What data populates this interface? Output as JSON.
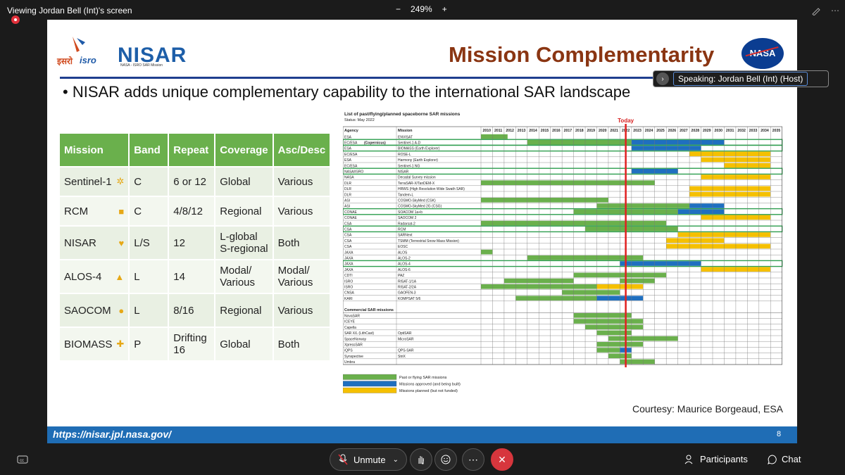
{
  "window": {
    "title": "Viewing Jordan Bell (Int)'s screen",
    "zoom": "249%",
    "zoom_minus": "−",
    "zoom_plus": "+"
  },
  "slide": {
    "isro_hindi": "इसरो",
    "isro_text": "isro",
    "nisar_logo": "NISAR",
    "nisar_sub": "NASA - ISRO SAR Mission",
    "title": "Mission Complementarity",
    "nasa_logo": "NASA",
    "bullet": "• NISAR adds unique complementary capability to the international SAR landscape",
    "table_headers": [
      "Mission",
      "Band",
      "Repeat",
      "Coverage",
      "Asc/Desc"
    ],
    "table_rows": [
      {
        "mission": "Sentinel-1",
        "symbol": "✲",
        "band": "C",
        "repeat": "6 or 12",
        "coverage": "Global",
        "ascdesc": "Various"
      },
      {
        "mission": "RCM",
        "symbol": "■",
        "band": "C",
        "repeat": "4/8/12",
        "coverage": "Regional",
        "ascdesc": "Various"
      },
      {
        "mission": "NISAR",
        "symbol": "♥",
        "band": "L/S",
        "repeat": "12",
        "coverage": "L-global\nS-regional",
        "ascdesc": "Both"
      },
      {
        "mission": "ALOS-4",
        "symbol": "▲",
        "band": "L",
        "repeat": "14",
        "coverage": "Modal/\nVarious",
        "ascdesc": "Modal/\nVarious"
      },
      {
        "mission": "SAOCOM",
        "symbol": "●",
        "band": "L",
        "repeat": "8/16",
        "coverage": "Regional",
        "ascdesc": "Various"
      },
      {
        "mission": "BIOMASS",
        "symbol": "✚",
        "band": "P",
        "repeat": "Drifting\n16",
        "coverage": "Global",
        "ascdesc": "Both"
      }
    ],
    "courtesy": "Courtesy: Maurice Borgeaud, ESA",
    "footer_url": "https://nisar.jpl.nasa.gov/",
    "page_number": "8"
  },
  "chart_data": {
    "type": "table",
    "title": "List of past/flying/planned spaceborne SAR missions",
    "subtitle": "Status: May 2022",
    "today_label": "Today",
    "col_agency": "Agency",
    "col_mission": "Mission",
    "years": [
      "2010",
      "2011",
      "2012",
      "2013",
      "2014",
      "2015",
      "2016",
      "2017",
      "2018",
      "2019",
      "2020",
      "2021",
      "2022",
      "2023",
      "2024",
      "2025",
      "2026",
      "2027",
      "2028",
      "2029",
      "2030",
      "2031",
      "2032",
      "2033",
      "2034",
      "2035"
    ],
    "today_year": 2022.5,
    "status_colors": {
      "flying": "#6ab04c",
      "approved": "#1f6fc0",
      "planned": "#f5c000"
    },
    "rows": [
      {
        "agency": "ESA",
        "mission": "ENVISAT",
        "bars": [
          [
            2010,
            2012.3,
            "flying"
          ]
        ]
      },
      {
        "agency": "EC/ESA",
        "agency_note": "(Copernicus)",
        "mission": "Sentinel-1 A-D",
        "highlight": true,
        "bars": [
          [
            2014,
            2023,
            "flying"
          ],
          [
            2023,
            2031,
            "approved"
          ]
        ]
      },
      {
        "agency": "ESA",
        "mission": "BIOMASS (Earth Explorer)",
        "highlight": true,
        "bars": [
          [
            2023,
            2029,
            "approved"
          ]
        ]
      },
      {
        "agency": "EC/ESA",
        "mission": "ROSE-L",
        "bars": [
          [
            2028,
            2035,
            "planned"
          ]
        ]
      },
      {
        "agency": "ESA",
        "mission": "Harmony (Earth Explorer)",
        "bars": [
          [
            2029,
            2035,
            "planned"
          ]
        ]
      },
      {
        "agency": "EC/ESA",
        "mission": "Sentinel-1 NG",
        "bars": [
          [
            2031,
            2035,
            "planned"
          ]
        ]
      },
      {
        "agency": "NASA/ISRO",
        "mission": "NISAR",
        "highlight": true,
        "bars": [
          [
            2023,
            2027,
            "approved"
          ]
        ]
      },
      {
        "agency": "NASA",
        "mission": "Decadal Survey mission",
        "bars": [
          [
            2029,
            2035,
            "planned"
          ]
        ]
      },
      {
        "agency": "DLR",
        "mission": "TerraSAR-X/TanDEM-X",
        "bars": [
          [
            2010,
            2025,
            "flying"
          ]
        ]
      },
      {
        "agency": "DLR",
        "mission": "HRWS (High Resolution Wide Swath SAR)",
        "bars": [
          [
            2028,
            2035,
            "planned"
          ]
        ]
      },
      {
        "agency": "DLR",
        "mission": "Tandem-L",
        "bars": [
          [
            2028,
            2035,
            "planned"
          ]
        ]
      },
      {
        "agency": "ASI",
        "mission": "COSMO-SkyMed (CSK)",
        "bars": [
          [
            2010,
            2021,
            "flying"
          ]
        ]
      },
      {
        "agency": "ASI",
        "mission": "COSMO-SkyMed 2G (CSG)",
        "bars": [
          [
            2020,
            2028,
            "flying"
          ],
          [
            2028,
            2031,
            "approved"
          ]
        ]
      },
      {
        "agency": "CONAE",
        "mission": "SOACOM 1a+b",
        "highlight": true,
        "bars": [
          [
            2018,
            2027,
            "flying"
          ],
          [
            2027,
            2031,
            "approved"
          ]
        ]
      },
      {
        "agency": "CONAE",
        "mission": "SAOCOM 2",
        "bars": [
          [
            2029,
            2035,
            "planned"
          ]
        ]
      },
      {
        "agency": "CSA",
        "mission": "Radarsat-2",
        "bars": [
          [
            2010,
            2026,
            "flying"
          ]
        ]
      },
      {
        "agency": "CSA",
        "mission": "RCM",
        "highlight": true,
        "bars": [
          [
            2019,
            2027,
            "flying"
          ]
        ]
      },
      {
        "agency": "CSA",
        "mission": "SARNext",
        "bars": [
          [
            2027,
            2035,
            "planned"
          ]
        ]
      },
      {
        "agency": "CSA",
        "mission": "TSMM (Terrestrial Snow Mass Mission)",
        "bars": [
          [
            2026,
            2031,
            "planned"
          ]
        ]
      },
      {
        "agency": "CSA",
        "mission": "EOSC",
        "bars": [
          [
            2026,
            2035,
            "planned"
          ]
        ]
      },
      {
        "agency": "JAXA",
        "mission": "ALOS",
        "bars": [
          [
            2010,
            2011,
            "flying"
          ]
        ]
      },
      {
        "agency": "JAXA",
        "mission": "ALOS-2",
        "bars": [
          [
            2014,
            2024,
            "flying"
          ]
        ]
      },
      {
        "agency": "JAXA",
        "mission": "ALOS-4",
        "highlight": true,
        "bars": [
          [
            2022,
            2029,
            "approved"
          ]
        ]
      },
      {
        "agency": "JAXA",
        "mission": "ALOS-6",
        "bars": [
          [
            2029,
            2035,
            "planned"
          ]
        ]
      },
      {
        "agency": "CDTI",
        "mission": "PAZ",
        "bars": [
          [
            2018,
            2026,
            "flying"
          ]
        ]
      },
      {
        "agency": "ISRO",
        "mission": "RISAT-1/1A",
        "bars": [
          [
            2012,
            2018,
            "flying"
          ],
          [
            2022,
            2025,
            "flying"
          ]
        ]
      },
      {
        "agency": "ISRO",
        "mission": "RISAT-2/2A",
        "bars": [
          [
            2010,
            2020,
            "flying"
          ],
          [
            2020,
            2024,
            "planned"
          ]
        ]
      },
      {
        "agency": "CNSA",
        "mission": "GAOFEN-3",
        "bars": [
          [
            2017,
            2022,
            "flying"
          ]
        ]
      },
      {
        "agency": "KARI",
        "mission": "KOMPSAT 5/6",
        "bars": [
          [
            2013,
            2020,
            "flying"
          ],
          [
            2020,
            2024,
            "approved"
          ]
        ]
      }
    ],
    "commercial_header": "Commercial SAR missions",
    "commercial_rows": [
      {
        "agency": "NovaSAR",
        "mission": "",
        "bars": [
          [
            2018,
            2023,
            "flying"
          ]
        ]
      },
      {
        "agency": "ICEYE",
        "mission": "",
        "bars": [
          [
            2018,
            2024,
            "flying"
          ]
        ]
      },
      {
        "agency": "Capella",
        "mission": "",
        "bars": [
          [
            2019,
            2024,
            "flying"
          ]
        ]
      },
      {
        "agency": "SAR X/L (LithCast)",
        "mission": "OptiSAR",
        "bars": [
          [
            2020,
            2023,
            "flying"
          ]
        ]
      },
      {
        "agency": "SpaceNorway",
        "mission": "MicroSAR",
        "bars": [
          [
            2021,
            2027,
            "flying"
          ]
        ]
      },
      {
        "agency": "XpressSAR",
        "mission": "",
        "bars": [
          [
            2020,
            2024,
            "flying"
          ]
        ]
      },
      {
        "agency": "iQPS",
        "mission": "QPS-SAR",
        "bars": [
          [
            2020,
            2022,
            "flying"
          ],
          [
            2022,
            2023,
            "approved"
          ]
        ]
      },
      {
        "agency": "Synspective",
        "mission": "StriX",
        "bars": [
          [
            2021,
            2023,
            "flying"
          ]
        ]
      },
      {
        "agency": "Umbra",
        "mission": "",
        "bars": [
          [
            2022,
            2025,
            "flying"
          ]
        ]
      }
    ],
    "legend": [
      {
        "label": "Past or flying SAR missions",
        "status": "flying"
      },
      {
        "label": "Missions approved (and being built)",
        "status": "approved"
      },
      {
        "label": "Missions planned (but not funded)",
        "status": "planned"
      }
    ]
  },
  "speaker": {
    "label_prefix": "Speaking: ",
    "name": "Jordan Bell (Int) (Host)"
  },
  "controls": {
    "unmute": "Unmute",
    "participants": "Participants",
    "chat": "Chat"
  }
}
